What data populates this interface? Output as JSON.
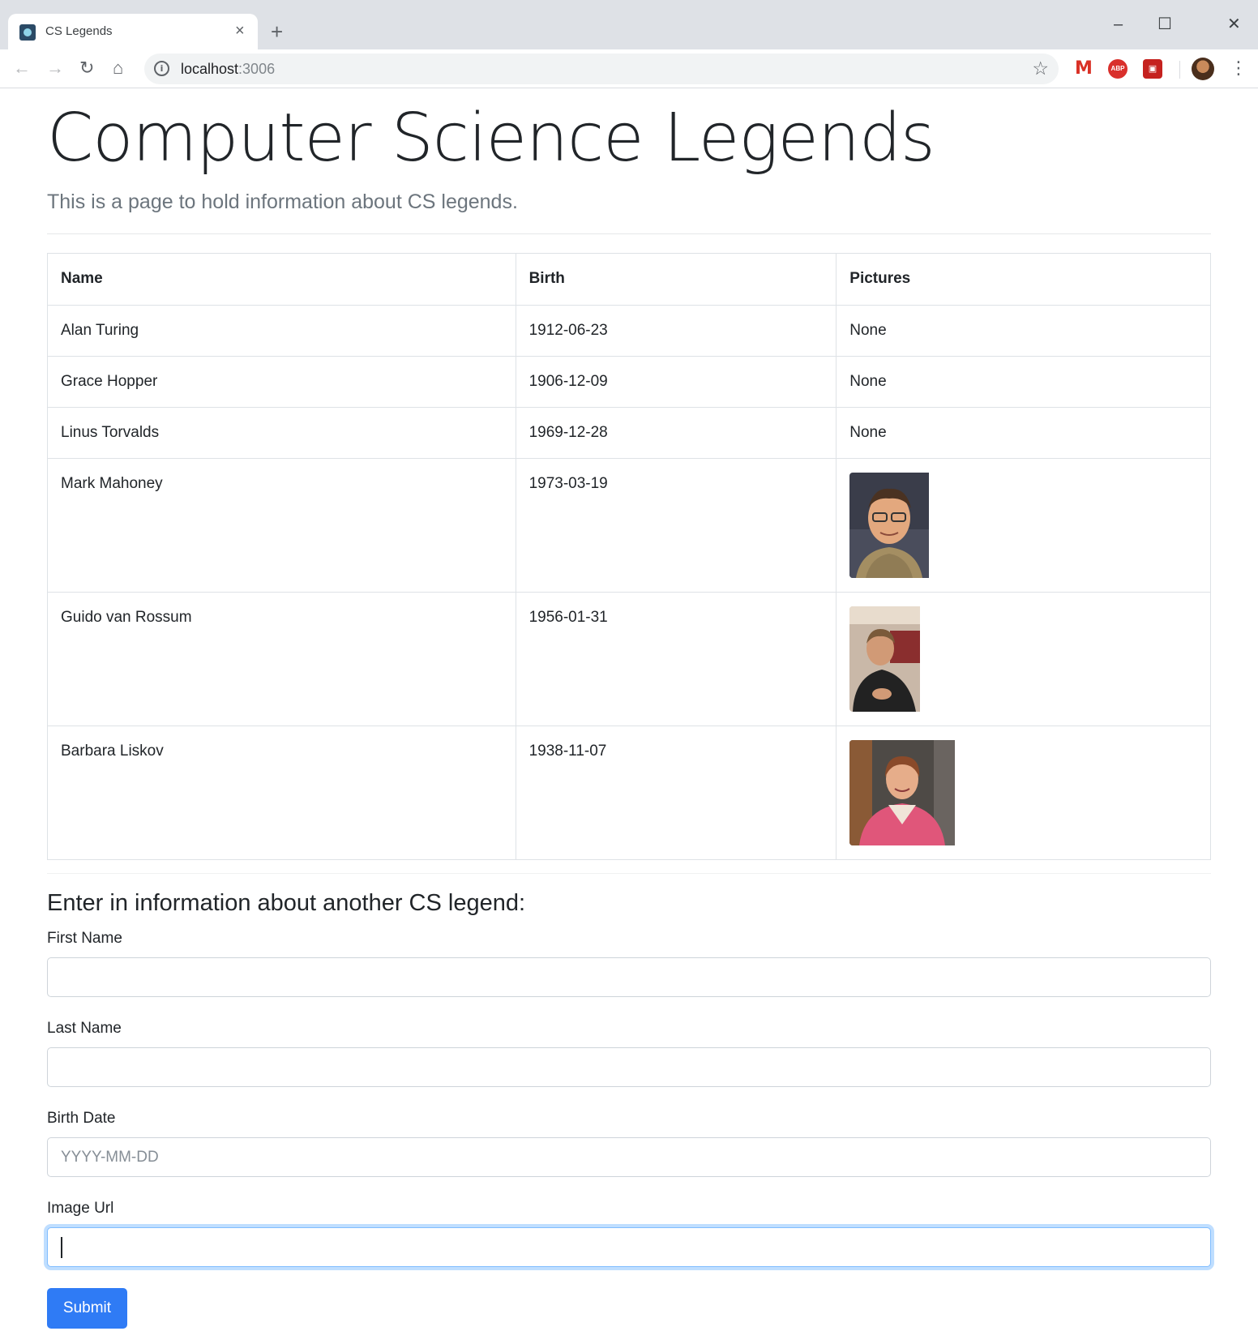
{
  "browser": {
    "tab_title": "CS Legends",
    "tab_close_glyph": "×",
    "new_tab_glyph": "+",
    "window_controls": {
      "minimize": "–",
      "maximize": "☐",
      "close": "✕"
    },
    "nav": {
      "back": "←",
      "forward": "→",
      "reload": "↻",
      "home": "⌂"
    },
    "url_host": "localhost",
    "url_port": ":3006",
    "bookmark_glyph": "☆",
    "extensions": {
      "gmail": "M",
      "adblock": "ABP",
      "pdf": "▣"
    },
    "menu_glyph": "⋮"
  },
  "page": {
    "title": "Computer Science Legends",
    "lead": "This is a page to hold information about CS legends."
  },
  "table": {
    "headers": {
      "name": "Name",
      "birth": "Birth",
      "pictures": "Pictures"
    },
    "rows": [
      {
        "name": "Alan Turing",
        "birth": "1912-06-23",
        "picture": "None"
      },
      {
        "name": "Grace Hopper",
        "birth": "1906-12-09",
        "picture": "None"
      },
      {
        "name": "Linus Torvalds",
        "birth": "1969-12-28",
        "picture": "None"
      },
      {
        "name": "Mark Mahoney",
        "birth": "1973-03-19",
        "picture": "photo"
      },
      {
        "name": "Guido van Rossum",
        "birth": "1956-01-31",
        "picture": "photo"
      },
      {
        "name": "Barbara Liskov",
        "birth": "1938-11-07",
        "picture": "photo"
      }
    ]
  },
  "form": {
    "heading": "Enter in information about another CS legend:",
    "first_name_label": "First Name",
    "first_name_value": "",
    "last_name_label": "Last Name",
    "last_name_value": "",
    "birth_date_label": "Birth Date",
    "birth_date_placeholder": "YYYY-MM-DD",
    "image_url_label": "Image Url",
    "image_url_value": "",
    "submit_label": "Submit"
  },
  "colors": {
    "primary": "#2f7bf5",
    "focus_ring": "#80bdff",
    "muted_text": "#6c757d",
    "chrome_bg": "#dee1e6"
  }
}
